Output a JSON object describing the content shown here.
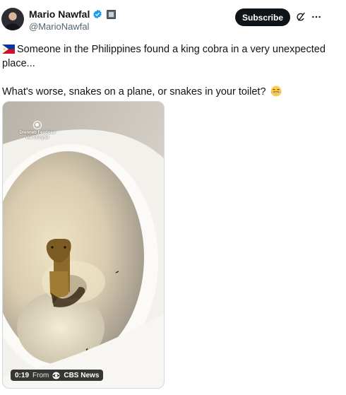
{
  "author": {
    "display_name": "Mario Nawfal",
    "handle": "@MarioNawfal",
    "icons": [
      "avatar",
      "verified-badge-icon",
      "affiliate-badge-icon"
    ]
  },
  "actions": {
    "subscribe_label": "Subscribe",
    "icons": [
      "grok-icon",
      "more-icon"
    ]
  },
  "tweet": {
    "paragraph1": "Someone in the Philippines found a king cobra in a very unexpected place...",
    "paragraph2": "What's worse, snakes on a plane, or snakes in your toilet?",
    "icons": [
      "philippines-flag-icon",
      "laughing-emoji-icon"
    ]
  },
  "media": {
    "watermark_line1": "Drenneb Feodoso",
    "watermark_line2": "via Storyful",
    "duration": "0:19",
    "from_label": "From",
    "source": "CBS News",
    "icons": [
      "storyful-logo-icon",
      "cbs-eye-icon"
    ]
  },
  "colors": {
    "accent_blue": "#1d9bf0",
    "text_primary": "#0f1419",
    "text_secondary": "#536471",
    "button_dark": "#0f1419"
  }
}
